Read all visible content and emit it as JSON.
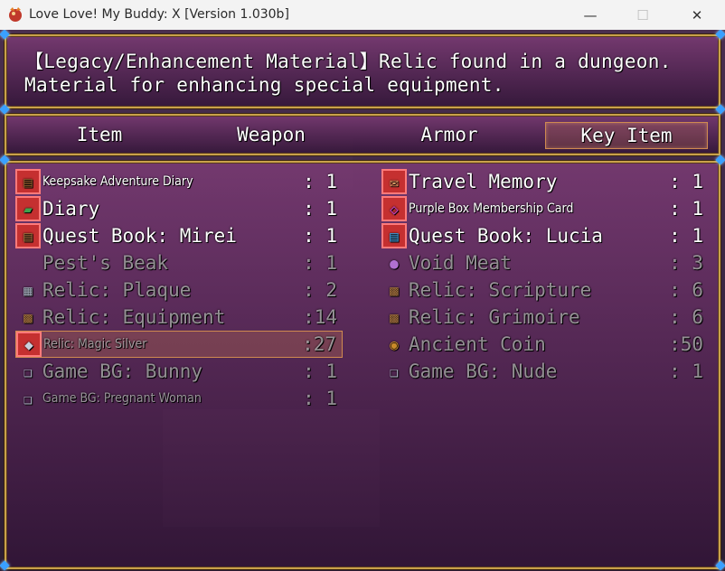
{
  "window": {
    "title": "Love Love! My Buddy: X [Version 1.030b]",
    "controls": {
      "minimize": "—",
      "maximize": "☐",
      "close": "✕"
    }
  },
  "help": {
    "line1": "【Legacy/Enhancement Material】Relic found in a dungeon.",
    "line2": "Material for enhancing special equipment."
  },
  "tabs": [
    {
      "label": "Item",
      "selected": false
    },
    {
      "label": "Weapon",
      "selected": false
    },
    {
      "label": "Armor",
      "selected": false
    },
    {
      "label": "Key Item",
      "selected": true
    }
  ],
  "items_left": [
    {
      "name": "Keepsake Adventure Diary",
      "qty": ": 1",
      "icon": "diary-icon",
      "small": true,
      "dim": false,
      "framed": true
    },
    {
      "name": "Diary",
      "qty": ": 1",
      "icon": "green-book-icon",
      "small": false,
      "dim": false,
      "framed": true
    },
    {
      "name": "Quest Book: Mirei",
      "qty": ": 1",
      "icon": "book-icon",
      "small": false,
      "dim": false,
      "framed": true
    },
    {
      "name": "Pest's Beak",
      "qty": ": 1",
      "icon": "blank-icon",
      "small": false,
      "dim": true,
      "framed": false
    },
    {
      "name": "Relic: Plaque",
      "qty": ": 2",
      "icon": "plaque-icon",
      "small": false,
      "dim": true,
      "framed": false
    },
    {
      "name": "Relic: Equipment",
      "qty": ":14",
      "icon": "chest-icon",
      "small": false,
      "dim": true,
      "framed": false
    },
    {
      "name": "Relic: Magic Silver",
      "qty": ":27",
      "icon": "silver-icon",
      "small": true,
      "dim": true,
      "framed": true,
      "selected": true
    },
    {
      "name": "Game BG: Bunny",
      "qty": ": 1",
      "icon": "open-book-icon",
      "small": false,
      "dim": true,
      "framed": false
    },
    {
      "name": "Game BG: Pregnant Woman",
      "qty": ": 1",
      "icon": "open-book-icon",
      "small": true,
      "dim": true,
      "framed": false
    }
  ],
  "items_right": [
    {
      "name": "Travel Memory",
      "qty": ": 1",
      "icon": "map-icon",
      "small": false,
      "dim": false,
      "framed": true
    },
    {
      "name": "Purple Box Membership Card",
      "qty": ": 1",
      "icon": "card-icon",
      "small": true,
      "dim": false,
      "framed": true
    },
    {
      "name": "Quest Book: Lucia",
      "qty": ": 1",
      "icon": "blue-book-icon",
      "small": false,
      "dim": false,
      "framed": true
    },
    {
      "name": "Void Meat",
      "qty": ": 3",
      "icon": "orb-icon",
      "small": false,
      "dim": true,
      "framed": false
    },
    {
      "name": "Relic: Scripture",
      "qty": ": 6",
      "icon": "chest-icon",
      "small": false,
      "dim": true,
      "framed": false
    },
    {
      "name": "Relic: Grimoire",
      "qty": ": 6",
      "icon": "chest-icon",
      "small": false,
      "dim": true,
      "framed": false
    },
    {
      "name": "Ancient Coin",
      "qty": ":50",
      "icon": "coin-icon",
      "small": false,
      "dim": true,
      "framed": false
    },
    {
      "name": "Game BG: Nude",
      "qty": ": 1",
      "icon": "open-book-icon",
      "small": false,
      "dim": true,
      "framed": false
    }
  ]
}
